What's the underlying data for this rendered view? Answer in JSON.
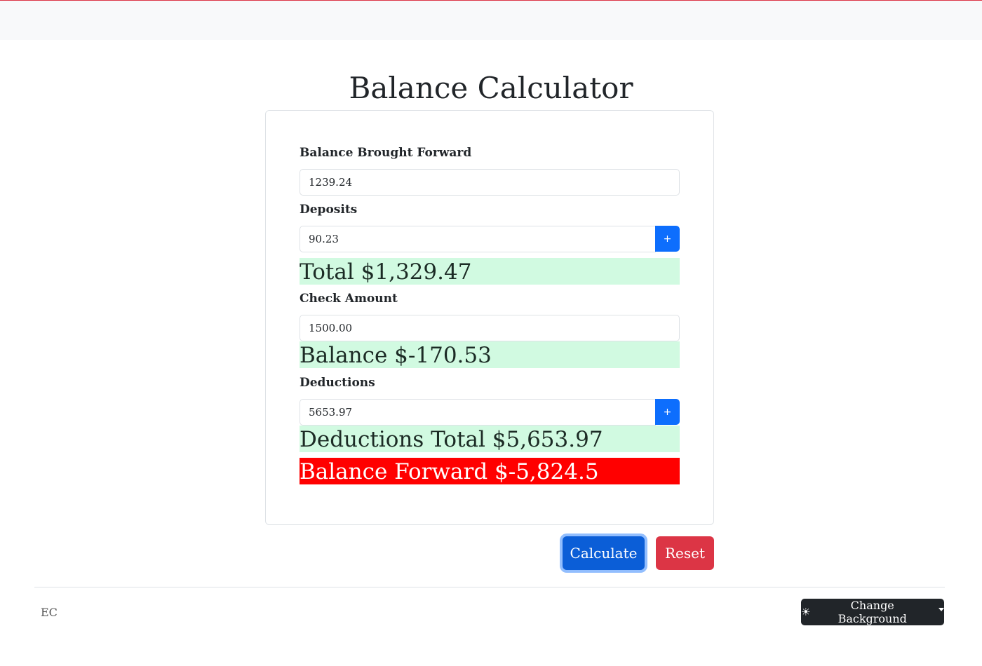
{
  "title": "Balance Calculator",
  "fields": {
    "balance_brought_forward": {
      "label": "Balance Brought Forward",
      "value": "1239.24"
    },
    "deposits": {
      "label": "Deposits",
      "value": "90.23",
      "add_label": "+"
    },
    "check_amount": {
      "label": "Check Amount",
      "value": "1500.00"
    },
    "deductions": {
      "label": "Deductions",
      "value": "5653.97",
      "add_label": "+"
    }
  },
  "results": {
    "total": "Total $1,329.47",
    "balance": "Balance $-170.53",
    "deductions_total": "Deductions Total $5,653.97",
    "balance_forward": "Balance Forward $-5,824.5"
  },
  "buttons": {
    "calculate": "Calculate",
    "reset": "Reset"
  },
  "footer": {
    "brand": "EC",
    "theme_button": "Change Background",
    "theme_icon": "sun-icon"
  },
  "colors": {
    "primary": "#0d6efd",
    "danger": "#dc3545",
    "success_bg": "#d1fae1",
    "alert_bg": "#ff0000"
  }
}
